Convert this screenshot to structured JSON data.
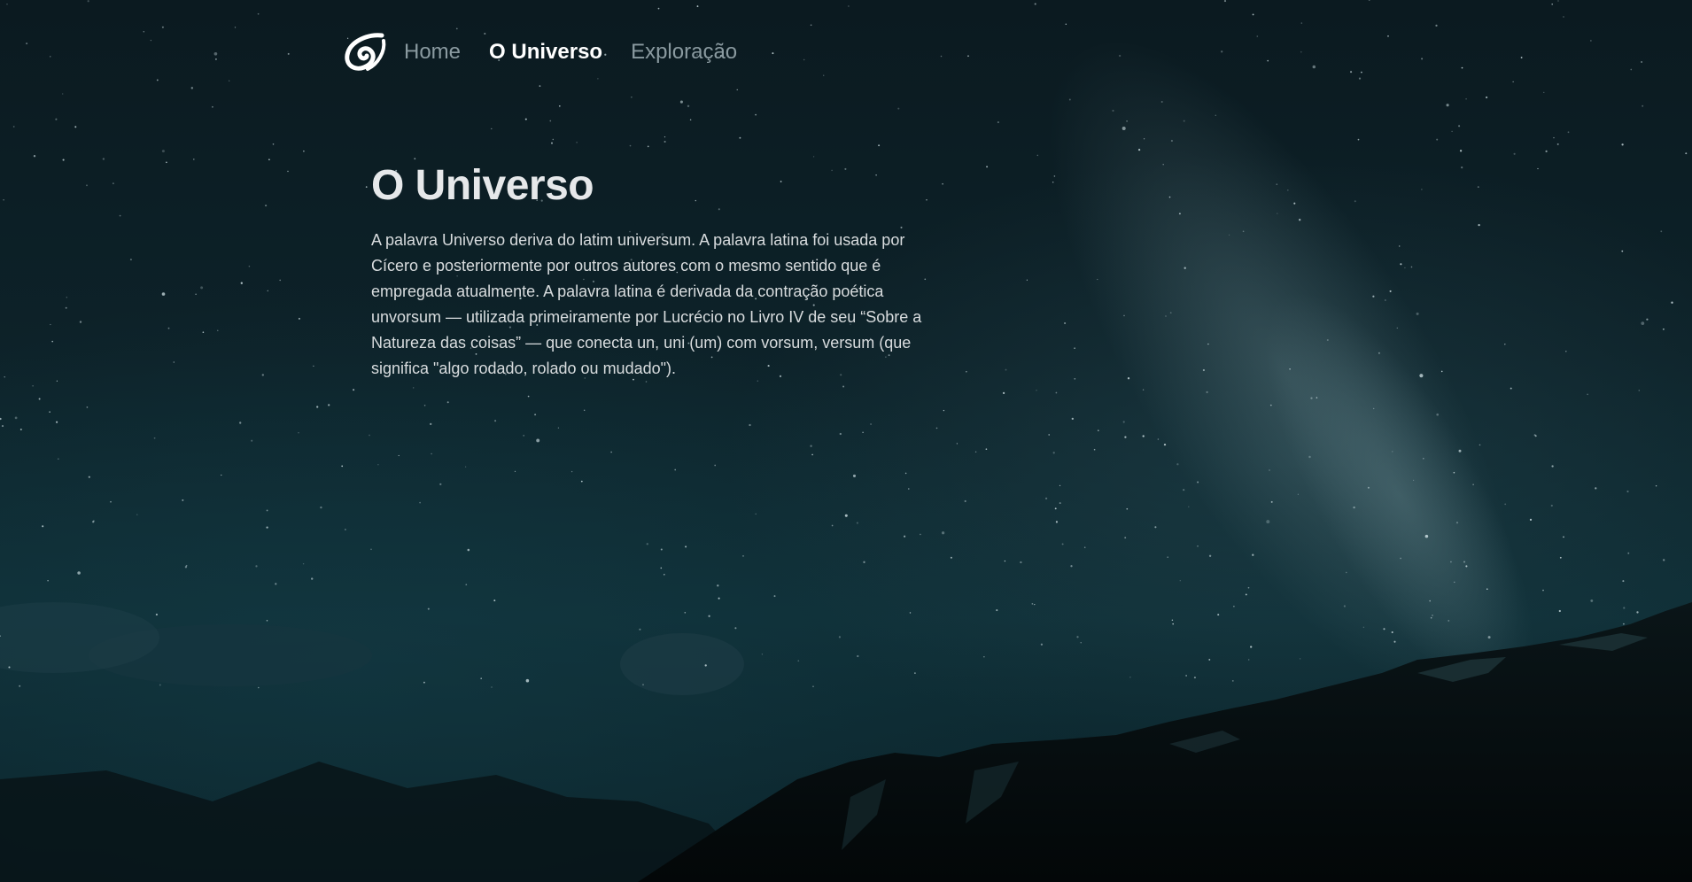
{
  "nav": {
    "logo_icon": "swirl-logo-icon",
    "items": [
      {
        "label": "Home",
        "active": false
      },
      {
        "label": "O Universo",
        "active": true
      },
      {
        "label": "Exploração",
        "active": false
      }
    ]
  },
  "main": {
    "title": "O Universo",
    "paragraph": "A palavra Universo deriva do latim universum. A palavra latina foi usada por Cícero e posteriormente por outros autores com o mesmo sentido que é empregada atualmente. A palavra latina é derivada da contração poética unvorsum — utilizada primeiramente por Lucrécio no Livro IV de seu “Sobre a Natureza das coisas” — que conecta un, uni (um) com vorsum, versum (que significa \"algo rodado, rolado ou mudado\")."
  },
  "colors": {
    "sky_top": "#0b1a20",
    "sky_bottom": "#0f2f37",
    "mountain": "#050b0d",
    "nav_inactive": "#8a9aa0",
    "nav_active": "#ffffff",
    "text": "#d8dcde"
  }
}
